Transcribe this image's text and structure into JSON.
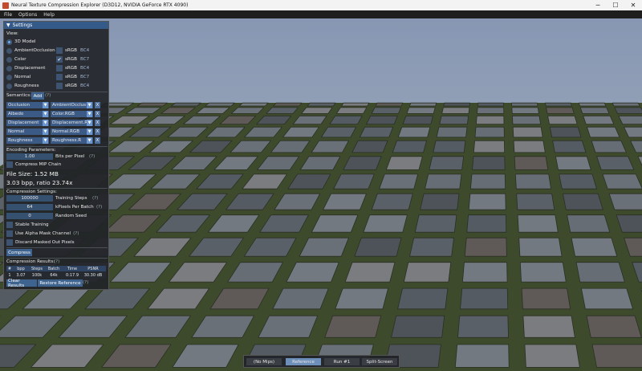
{
  "window": {
    "title": "Neural Texture Compression Explorer (D3D12, NVIDIA GeForce RTX 4090)",
    "minimize": "─",
    "maximize": "☐",
    "close": "✕"
  },
  "menu": [
    "File",
    "Options",
    "Help"
  ],
  "panel": {
    "title": "Settings",
    "view_label": "View:",
    "views": [
      {
        "label": "3D Model",
        "selected": true
      },
      {
        "label": "AmbientOcclusion",
        "srgb": false,
        "format": "BC4"
      },
      {
        "label": "Color",
        "srgb": true,
        "format": "BC7"
      },
      {
        "label": "Displacement",
        "srgb": false,
        "format": "BC4"
      },
      {
        "label": "Normal",
        "srgb": false,
        "format": "BC7"
      },
      {
        "label": "Roughness",
        "srgb": false,
        "format": "BC4"
      }
    ],
    "srgb_label": "sRGB",
    "semantics_label": "Semantics:",
    "add_label": "Add",
    "help": "(?)",
    "semantics": [
      {
        "semantic": "Occlusion",
        "channel": "AmbientOcclus"
      },
      {
        "semantic": "Albedo",
        "channel": "Color.RGB"
      },
      {
        "semantic": "Displacement",
        "channel": "Displacement.R"
      },
      {
        "semantic": "Normal",
        "channel": "Normal.RGB"
      },
      {
        "semantic": "Roughness",
        "channel": "Roughness.R"
      }
    ],
    "remove_label": "X",
    "encoding_label": "Encoding Parameters:",
    "bits_per_pixel": {
      "value": "1.00",
      "label": "Bits per Pixel"
    },
    "compress_mip": "Compress MIP Chain",
    "file_size": "File Size: 1.52 MB",
    "bpp_ratio": "3.03 bpp, ratio 23.74x",
    "compression_settings_label": "Compression Settings:",
    "training_steps": {
      "value": "100000",
      "label": "Training Steps"
    },
    "kpixels": {
      "value": "64",
      "label": "kPixels Per Batch"
    },
    "seed": {
      "value": "0",
      "label": "Random Seed"
    },
    "stable_training": "Stable Training",
    "alpha_mask": "Use Alpha Mask Channel",
    "discard_masked": "Discard Masked Out Pixels",
    "compress_button": "Compress",
    "results_label": "Compression Results:",
    "results_headers": [
      "#",
      "bpp",
      "Steps",
      "Batch",
      "Time",
      "PSNR"
    ],
    "results_rows": [
      [
        "1",
        "3.07",
        "100k",
        "64k",
        "0:17.9",
        "30.30 dB"
      ]
    ],
    "clear_results": "Clear Results",
    "restore_reference": "Restore Reference"
  },
  "bottom_tabs": [
    {
      "label": "(No Mips)",
      "selected": false
    },
    {
      "label": "Reference",
      "selected": true
    },
    {
      "label": "Run #1",
      "selected": false
    },
    {
      "label": "Split-Screen",
      "selected": false
    }
  ],
  "colors": {
    "accent": "#3f638f",
    "panel": "#222428",
    "sky": "#8797b3"
  }
}
